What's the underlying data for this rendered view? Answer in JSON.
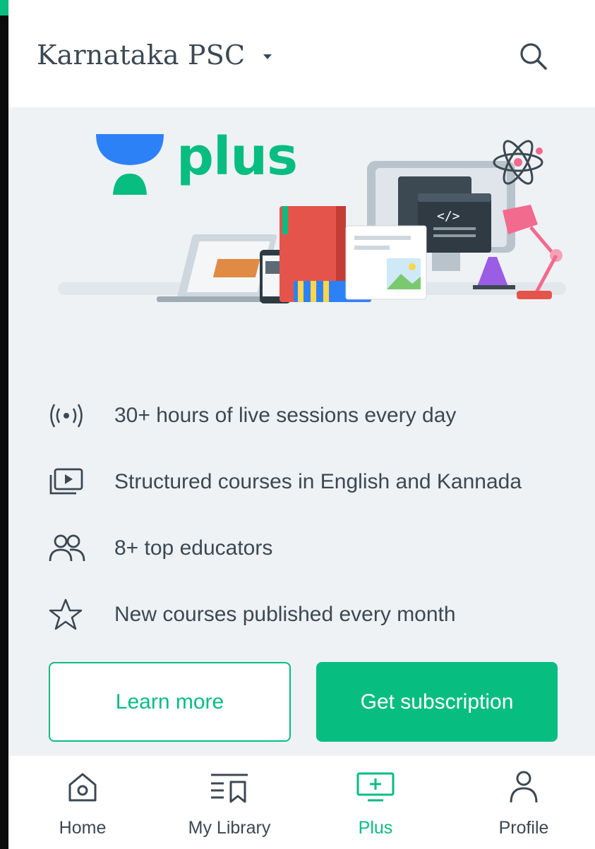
{
  "header": {
    "goal_title": "Karnataka PSC",
    "caret_icon": "caret-down-icon",
    "search_icon": "search-icon"
  },
  "promo": {
    "brand_word": "plus",
    "brand_icon": "unacademy-logo",
    "illustration": "devices-books-lamp-illustration"
  },
  "features": [
    {
      "icon": "live-broadcast-icon",
      "text": "30+ hours of live sessions every day"
    },
    {
      "icon": "video-courses-icon",
      "text": "Structured courses in English and Kannada"
    },
    {
      "icon": "educators-icon",
      "text": "8+ top educators"
    },
    {
      "icon": "star-icon",
      "text": "New courses published every month"
    }
  ],
  "buttons": {
    "learn_more": "Learn more",
    "get_subscription": "Get subscription"
  },
  "bottom_nav": [
    {
      "icon": "home-icon",
      "label": "Home",
      "active": false
    },
    {
      "icon": "library-icon",
      "label": "My Library",
      "active": false
    },
    {
      "icon": "plus-screen-icon",
      "label": "Plus",
      "active": true
    },
    {
      "icon": "profile-icon",
      "label": "Profile",
      "active": false
    }
  ],
  "colors": {
    "accent": "#08bd80",
    "text": "#3c4852",
    "panel_bg": "#eef2f5",
    "brand_blue": "#2d81f7"
  }
}
